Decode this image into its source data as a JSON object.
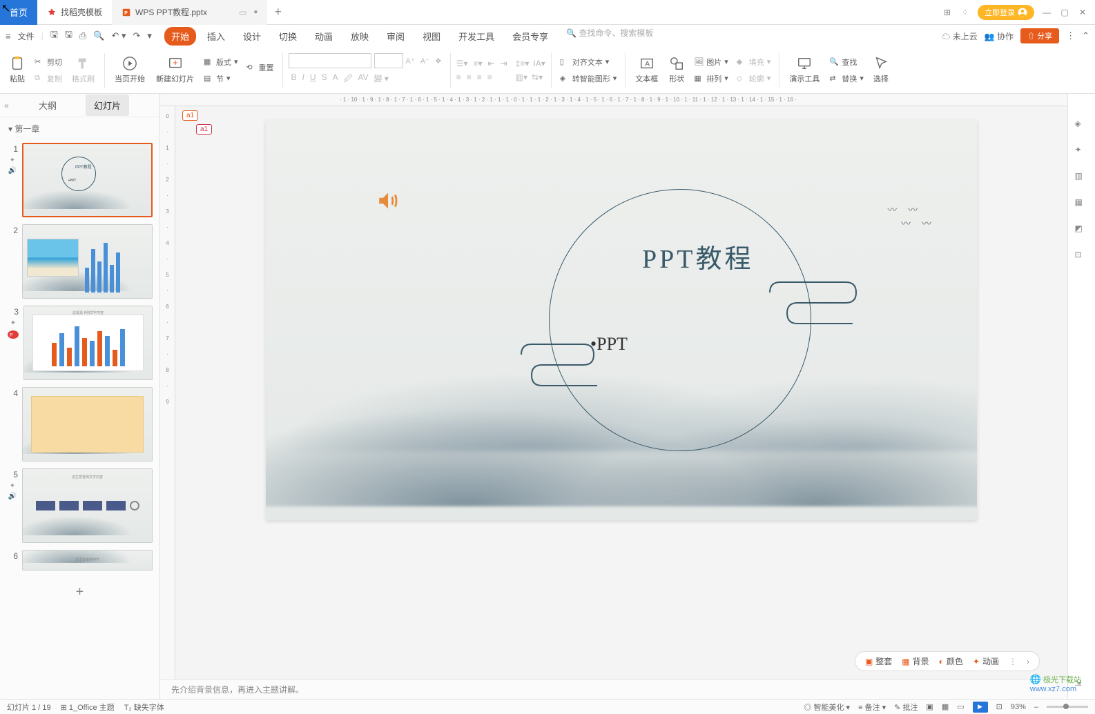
{
  "titlebar": {
    "home_tab": "首页",
    "template_tab": "找稻壳模板",
    "doc_tab": "WPS PPT教程.pptx",
    "login": "立即登录"
  },
  "menubar": {
    "file": "文件",
    "tabs": {
      "start": "开始",
      "insert": "插入",
      "design": "设计",
      "transition": "切换",
      "animation": "动画",
      "slideshow": "放映",
      "review": "审阅",
      "view": "视图",
      "dev": "开发工具",
      "vip": "会员专享"
    },
    "search_placeholder": "查找命令、搜索模板",
    "cloud": "未上云",
    "collab": "协作",
    "share": "分享"
  },
  "ribbon": {
    "paste": "粘贴",
    "cut": "剪切",
    "copy": "复制",
    "format_painter": "格式刷",
    "from_current": "当页开始",
    "new_slide": "新建幻灯片",
    "layout": "版式",
    "reset": "重置",
    "section": "节",
    "align_text": "对齐文本",
    "convert_shape": "转智能图形",
    "textbox": "文本框",
    "shapes": "形状",
    "pictures": "图片",
    "arrange": "排列",
    "fill": "填充",
    "outline": "轮廓",
    "present_tool": "演示工具",
    "find": "查找",
    "replace": "替换",
    "select": "选择"
  },
  "sidebar": {
    "outline_tab": "大纲",
    "slides_tab": "幻灯片",
    "section1": "第一章",
    "slide_numbers": [
      "1",
      "2",
      "3",
      "4",
      "5",
      "6"
    ]
  },
  "slide": {
    "title": "PPT教程",
    "subtitle": "•PPT",
    "comment1": "a1",
    "comment2": "a1",
    "th6_text": "这里是单例PPT",
    "th3_text": "这是是卡例文字内容",
    "th5_text": "这生意音例文字内容"
  },
  "slide_toolbar": {
    "template": "整套",
    "background": "背景",
    "color": "颜色",
    "animation": "动画"
  },
  "notes": {
    "text": "先介绍背景信息，再进入主题讲解。"
  },
  "statusbar": {
    "slide_pos": "幻灯片 1 / 19",
    "theme": "1_Office 主题",
    "missing_font": "缺失字体",
    "smart_beautify": "智能美化",
    "notes_btn": "备注",
    "comments_btn": "批注",
    "zoom": "93%"
  },
  "watermark": {
    "brand": "极光下载站",
    "url": "www.xz7.com"
  }
}
